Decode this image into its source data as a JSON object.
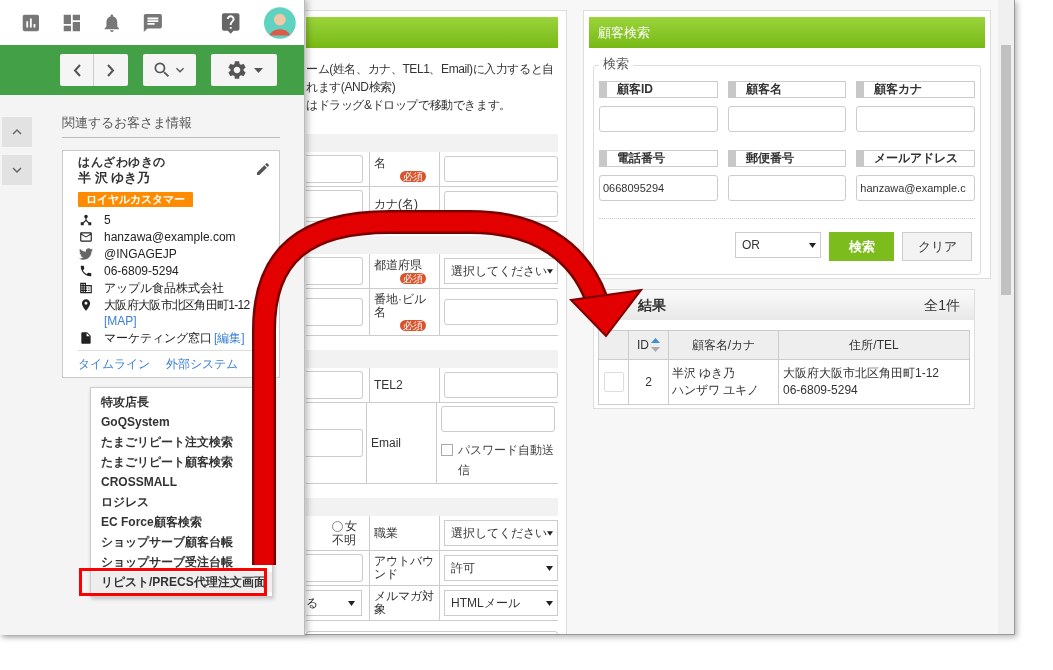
{
  "sidebar": {
    "panel_title": "関連するお客さま情報",
    "customer": {
      "ruby": "はんざわゆきの",
      "name": "半 沢 ゆき乃",
      "badge": "ロイヤルカスタマー",
      "details": [
        {
          "kind": "tree",
          "text": "5"
        },
        {
          "kind": "mail",
          "text": "hanzawa@example.com"
        },
        {
          "kind": "twitter",
          "text": "@INGAGEJP"
        },
        {
          "kind": "phone",
          "text": "06-6809-5294"
        },
        {
          "kind": "company",
          "text": "アップル食品株式会社"
        },
        {
          "kind": "address",
          "text": "大阪府大阪市北区角田町1-12",
          "link": "[MAP]"
        },
        {
          "kind": "note",
          "text": "マーケティング窓口",
          "link": "[編集]"
        }
      ]
    },
    "links": [
      "タイムライン",
      "外部システム"
    ],
    "menu": [
      {
        "label": "特攻店長",
        "selected": false,
        "boxed": false
      },
      {
        "label": "GoQSystem",
        "selected": false,
        "boxed": false
      },
      {
        "label": "たまごリピート注文検索",
        "selected": false,
        "boxed": false
      },
      {
        "label": "たまごリピート顧客検索",
        "selected": false,
        "boxed": false
      },
      {
        "label": "CROSSMALL",
        "selected": false,
        "boxed": false
      },
      {
        "label": "ロジレス",
        "selected": false,
        "boxed": false
      },
      {
        "label": "EC Force顧客検索",
        "selected": false,
        "boxed": false
      },
      {
        "label": "ショップサーブ顧客台帳",
        "selected": false,
        "boxed": false
      },
      {
        "label": "ショップサーブ受注台帳",
        "selected": false,
        "boxed": false
      },
      {
        "label": "リピスト/PRECS代理注文画面",
        "selected": true,
        "boxed": true
      }
    ]
  },
  "form": {
    "intro_lines": [
      "ーム(姓名、カナ、TEL1、Email)に入力すると自",
      "れます(AND検索)",
      "はドラッグ&ドロップで移動できます。"
    ],
    "sections": [
      {
        "rows": [
          {
            "label": "名",
            "badge": "必須",
            "kind": "input",
            "left": {
              "kind": "input"
            }
          },
          {
            "label": "カナ(名)",
            "kind": "input",
            "left": {
              "kind": "input"
            }
          }
        ]
      },
      {
        "rows": [
          {
            "label": "都道府県",
            "badge": "必須",
            "kind": "select",
            "value": "選択してください",
            "left": {
              "kind": "input"
            }
          },
          {
            "label": "番地·ビル名",
            "badge": "必須",
            "kind": "input",
            "left": {
              "kind": "input"
            }
          }
        ]
      },
      {
        "rows": [
          {
            "label": "TEL2",
            "kind": "input",
            "left": {
              "kind": "input"
            }
          },
          {
            "label": "Email",
            "kind": "email",
            "checkbox": {
              "label": "パスワード自動送信",
              "checked": false
            },
            "left": {
              "kind": "input"
            }
          }
        ]
      },
      {
        "rows": [
          {
            "label": "職業",
            "kind": "select",
            "value": "選択してください",
            "left": {
              "kind": "radio",
              "options": [
                {
                  "label": "女",
                  "selected": false
                },
                {
                  "label": "不明",
                  "selected": false
                }
              ]
            }
          },
          {
            "label": "アウトバウンド",
            "kind": "select",
            "value": "許可",
            "left": {
              "kind": "input"
            }
          },
          {
            "label": "メルマガ対象",
            "kind": "select",
            "value": "HTMLメール",
            "left": {
              "kind": "select",
              "value": "る"
            }
          }
        ]
      }
    ]
  },
  "search": {
    "title": "顧客検索",
    "legend": "検索",
    "fields": [
      {
        "label": "顧客ID"
      },
      {
        "label": "顧客名"
      },
      {
        "label": "顧客カナ"
      },
      {
        "label": "電話番号",
        "value": "0668095294"
      },
      {
        "label": "郵便番号"
      },
      {
        "label": "メールアドレス",
        "value": "hanzawa@example.c"
      }
    ],
    "match_mode": "OR",
    "buttons": [
      {
        "kind": "primary",
        "label": "検索"
      },
      {
        "kind": "default",
        "label": "クリア"
      }
    ]
  },
  "results": {
    "title": "結果",
    "count": "全1件",
    "columns": [
      "ID",
      "顧客名/カナ",
      "住所/TEL"
    ],
    "rows": [
      {
        "checked": false,
        "id": "2",
        "name": "半沢 ゆき乃",
        "kana": "ハンザワ ユキノ",
        "address": "大阪府大阪市北区角田町1-12",
        "tel": "06-6809-5294"
      }
    ]
  }
}
